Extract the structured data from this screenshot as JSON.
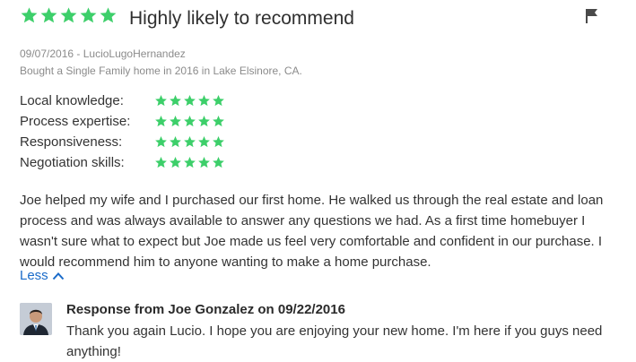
{
  "review": {
    "overall_rating": 5,
    "overall_rating_max": 5,
    "headline": "Highly likely to recommend",
    "date_author": "09/07/2016 - LucioLugoHernandez",
    "transaction": "Bought a Single Family home in 2016 in Lake Elsinore, CA.",
    "ratings": [
      {
        "label": "Local knowledge:",
        "stars": 5
      },
      {
        "label": "Process expertise:",
        "stars": 5
      },
      {
        "label": "Responsiveness:",
        "stars": 5
      },
      {
        "label": "Negotiation skills:",
        "stars": 5
      }
    ],
    "body": "Joe helped my wife and I purchased our first home. He walked us through the real estate and loan process and was always  available to answer any questions we had. As a first time homebuyer I wasn't sure what to expect but Joe made us feel very comfortable and confident in our purchase. I would recommend him to anyone wanting to make a home purchase.",
    "less_label": "Less"
  },
  "response": {
    "title": "Response from Joe Gonzalez on 09/22/2016",
    "body": "Thank you again Lucio. I hope you are enjoying your new home. I'm here if you guys need anything!"
  },
  "icons": {
    "star": "star-icon",
    "flag": "flag-icon",
    "chevron": "chevron-up-icon"
  },
  "colors": {
    "star_green": "#3dcf6a",
    "link_blue": "#1a6bc9",
    "meta_gray": "#8b8b8b"
  }
}
